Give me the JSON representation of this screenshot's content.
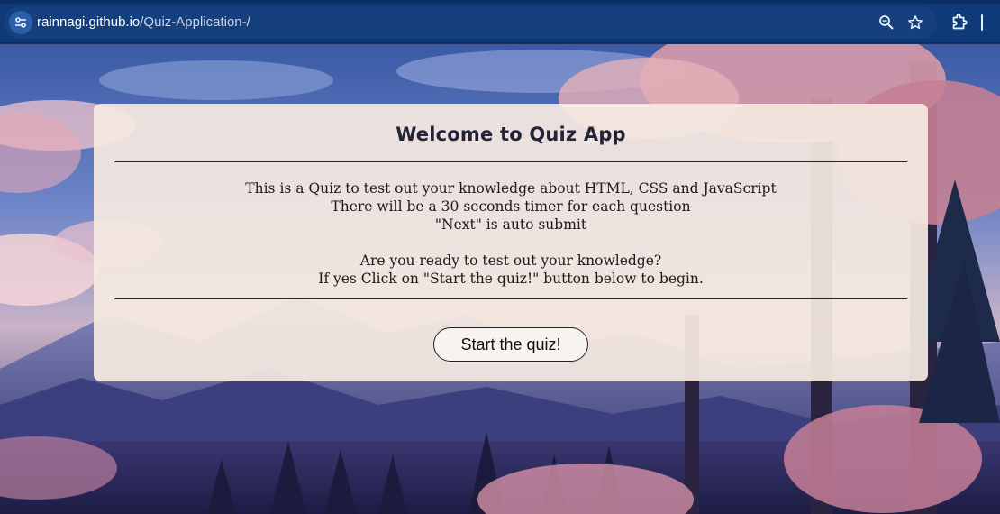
{
  "browser": {
    "url_host": "rainnagi.github.io",
    "url_path": "/Quiz-Application-/",
    "icons": [
      "site-info-tune-icon",
      "zoom-icon",
      "bookmark-star-icon",
      "extensions-puzzle-icon"
    ]
  },
  "quiz": {
    "title": "Welcome to Quiz App",
    "intro_lines": [
      "This is a Quiz to test out your knowledge about HTML, CSS and JavaScript",
      "There will be a 30 seconds timer for each question",
      "\"Next\" is auto submit"
    ],
    "prompt_lines": [
      "Are you ready to test out your knowledge?",
      "If yes Click on \"Start the quiz!\" button below to begin."
    ],
    "start_button": "Start the quiz!"
  },
  "colors": {
    "chrome_bg": "#0f3a78",
    "omnibox_bg": "#163f7d",
    "card_bg": "#f5eae1",
    "title_text": "#22243a"
  }
}
